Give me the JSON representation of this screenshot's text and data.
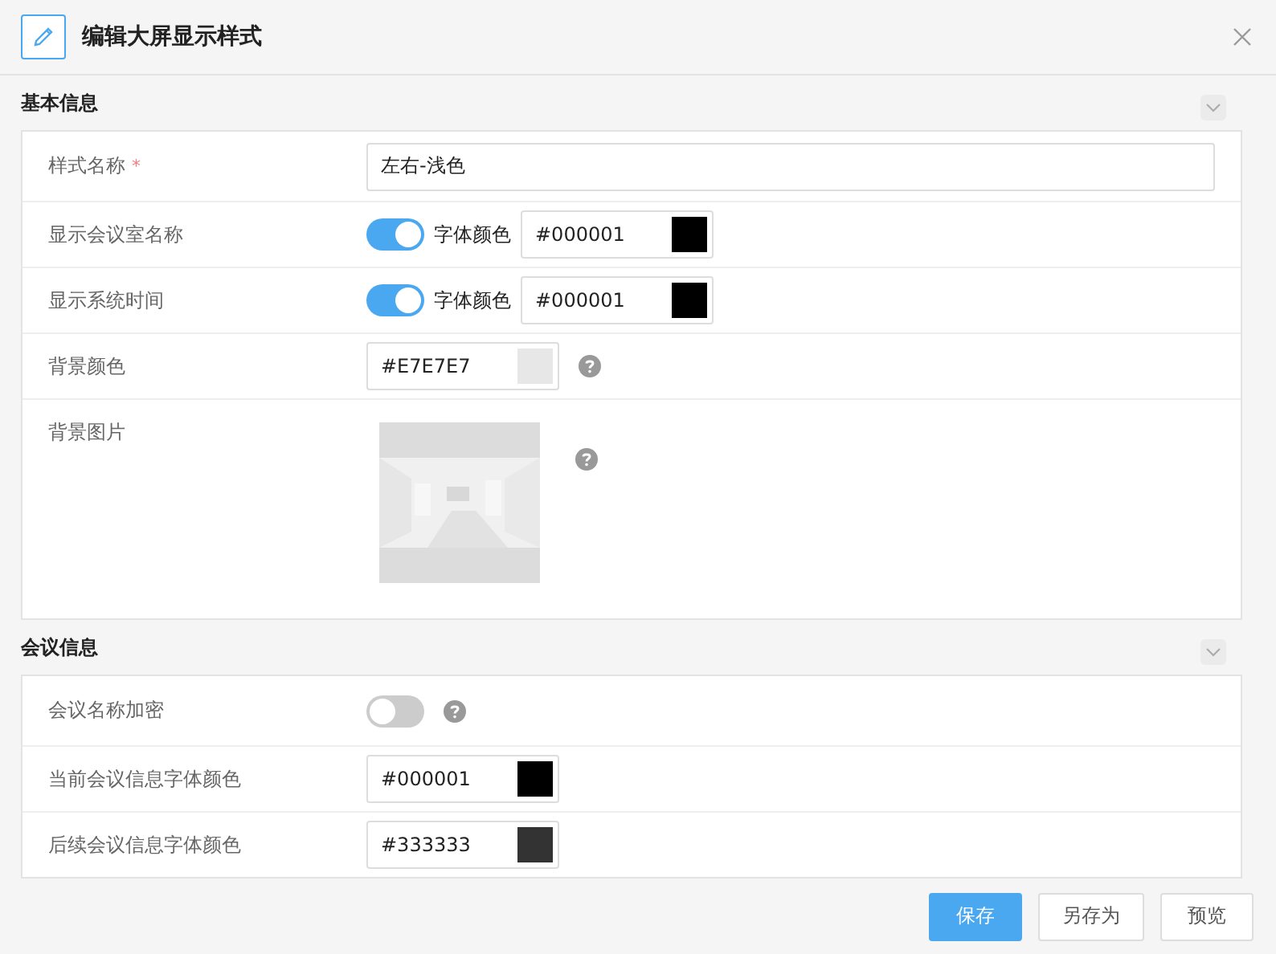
{
  "dialog": {
    "title": "编辑大屏显示样式"
  },
  "sections": [
    {
      "title": "基本信息",
      "expanded": true,
      "rows": [
        {
          "kind": "text",
          "label": "样式名称",
          "required_mark": "*",
          "value": "左右-浅色"
        },
        {
          "kind": "toggle_color",
          "label": "显示会议室名称",
          "on": true,
          "color_label": "字体颜色",
          "value": "#000001",
          "color": "#000001"
        },
        {
          "kind": "toggle_color",
          "label": "显示系统时间",
          "on": true,
          "color_label": "字体颜色",
          "value": "#000001",
          "color": "#000001"
        },
        {
          "kind": "color",
          "label": "背景颜色",
          "value": "#E7E7E7",
          "color": "#e7e7e7",
          "help": true
        },
        {
          "label": "背景图片",
          "help": true
        }
      ]
    },
    {
      "title": "会议信息",
      "expanded": true,
      "rows": [
        {
          "kind": "toggle",
          "label": "会议名称加密",
          "on": false,
          "help": true
        },
        {
          "kind": "color",
          "label": "当前会议信息字体颜色",
          "value": "#000001",
          "color": "#000001"
        },
        {
          "kind": "color",
          "label": "后续会议信息字体颜色",
          "value": "#333333",
          "color": "#333333"
        }
      ]
    }
  ],
  "buttons": [
    {
      "label": "保存",
      "kind": "primary"
    },
    {
      "label": "另存为",
      "kind": "default"
    },
    {
      "label": "预览",
      "kind": "default"
    }
  ]
}
